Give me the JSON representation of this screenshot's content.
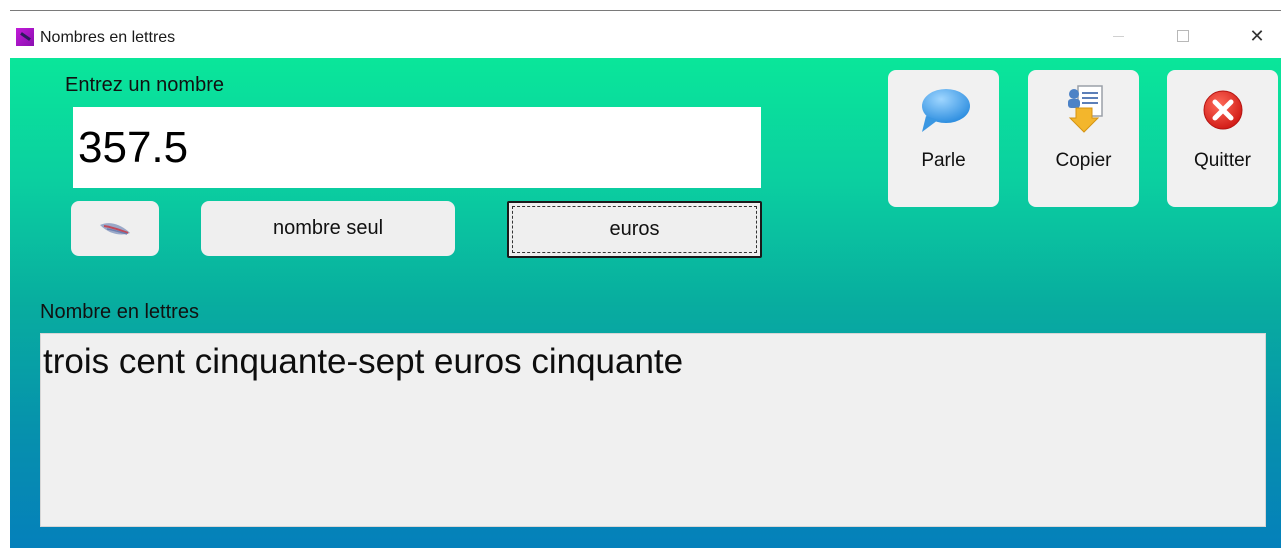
{
  "window": {
    "title": "Nombres en lettres",
    "close_glyph": "✕"
  },
  "input": {
    "label": "Entrez un nombre",
    "value": "357.5"
  },
  "buttons": {
    "nombre_seul": "nombre seul",
    "euros": "euros"
  },
  "toolbar": {
    "parle": "Parle",
    "copier": "Copier",
    "quitter": "Quitter"
  },
  "output": {
    "label": "Nombre en lettres",
    "text": "trois cent cinquante-sept euros cinquante"
  },
  "icons": {
    "app": "app-icon",
    "feather": "feather-icon",
    "speech": "speech-bubble-icon",
    "copy": "copy-document-icon",
    "quit": "red-x-icon"
  },
  "colors": {
    "gradient_top": "#0ae69a",
    "gradient_bottom": "#0580bb",
    "button_bg": "#efefef"
  }
}
